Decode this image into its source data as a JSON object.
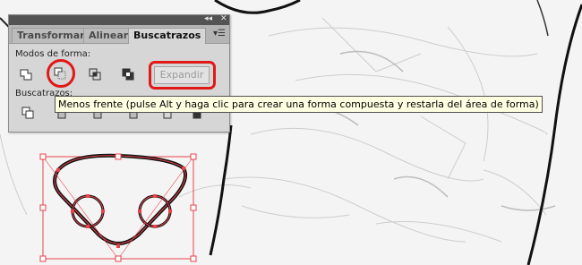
{
  "panel": {
    "collapse_glyph": "◂◂",
    "close_glyph": "✕",
    "tabs": [
      {
        "label": "Transformar",
        "active": false
      },
      {
        "label": "Alinear",
        "active": false
      },
      {
        "label": "Buscatrazos",
        "active": true
      }
    ],
    "menu_glyph": "▾☰",
    "shape_modes_label": "Modos de forma:",
    "shape_modes": [
      {
        "name": "unite-icon",
        "highlighted": false
      },
      {
        "name": "minus-front-icon",
        "highlighted": true
      },
      {
        "name": "intersect-icon",
        "highlighted": false
      },
      {
        "name": "exclude-icon",
        "highlighted": false
      }
    ],
    "expand_label": "Expandir",
    "pathfinders_label": "Buscatrazos:",
    "pathfinders": [
      {
        "name": "divide-icon"
      },
      {
        "name": "trim-icon"
      },
      {
        "name": "merge-icon"
      },
      {
        "name": "crop-icon"
      },
      {
        "name": "outline-icon"
      },
      {
        "name": "minus-back-icon"
      }
    ]
  },
  "tooltip": "Menos frente (pulse Alt y haga clic para crear una forma compuesta y restarla del área de forma)",
  "colors": {
    "highlight": "#e01818",
    "selection": "#e8434b",
    "tooltip_bg": "#ffffe1"
  }
}
